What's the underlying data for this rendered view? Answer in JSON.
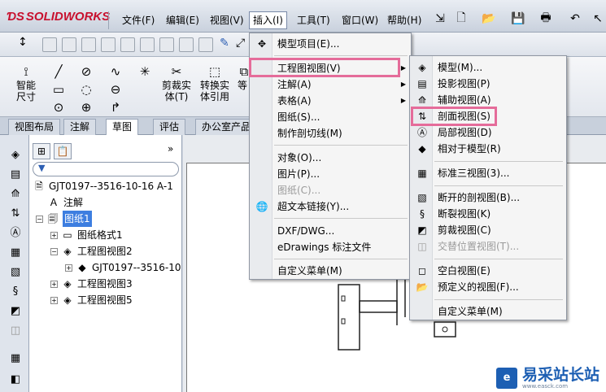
{
  "app": {
    "logo": "SOLIDWORKS"
  },
  "menubar": {
    "items": [
      "文件(F)",
      "编辑(E)",
      "视图(V)",
      "插入(I)",
      "工具(T)",
      "窗口(W)",
      "帮助(H)"
    ]
  },
  "sketch_toolbar": {
    "smart_dim": "智能尺寸",
    "trim": "剪裁实体(T)",
    "convert": "转换实体引用",
    "offset_partial": "等"
  },
  "tabs": [
    "视图布局",
    "注解",
    "草图",
    "评估",
    "办公室产品"
  ],
  "tree": {
    "root": "GJT0197--3516-10-16 A-1",
    "items": [
      {
        "label": "注解"
      },
      {
        "label": "图纸1"
      },
      {
        "label": "图纸格式1"
      },
      {
        "label": "工程图视图2"
      },
      {
        "label": "GJT0197--3516-10"
      },
      {
        "label": "工程图视图3"
      },
      {
        "label": "工程图视图5"
      }
    ]
  },
  "insert_menu": {
    "items": [
      "模型项目(E)...",
      "工程图视图(V)",
      "注解(A)",
      "表格(A)",
      "图纸(S)...",
      "制作剖切线(M)",
      "对象(O)...",
      "图片(P)...",
      "图纸(C)...",
      "超文本链接(Y)...",
      "DXF/DWG...",
      "eDrawings 标注文件",
      "自定义菜单(M)"
    ]
  },
  "sub_menu": {
    "items": [
      "模型(M)...",
      "投影视图(P)",
      "辅助视图(A)",
      "剖面视图(S)",
      "局部视图(D)",
      "相对于模型(R)",
      "标准三视图(3)...",
      "断开的剖视图(B)...",
      "断裂视图(K)",
      "剪裁视图(C)",
      "交替位置视图(T)...",
      "空白视图(E)",
      "预定义的视图(F)...",
      "自定义菜单(M)"
    ]
  },
  "watermark": {
    "title": "易采站长站",
    "subtitle": "www.easck.com"
  },
  "colors": {
    "highlight": "#e56c9a",
    "brand": "#c8102e",
    "selection": "#3d7ee0"
  }
}
